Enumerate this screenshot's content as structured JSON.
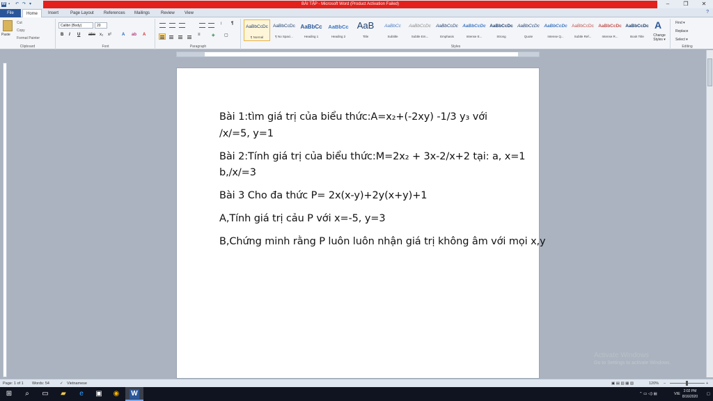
{
  "window": {
    "title": "BÀI TẬP - Microsoft Word (Product Activation Failed)",
    "controls": [
      "–",
      "❐",
      "✕"
    ]
  },
  "qat": {
    "logo": "W"
  },
  "tabs": [
    "File",
    "Home",
    "Insert",
    "Page Layout",
    "References",
    "Mailings",
    "Review",
    "View"
  ],
  "active_tab": "Home",
  "ribbon": {
    "clipboard": {
      "label": "Clipboard",
      "paste": "Paste",
      "cut": "Cut",
      "copy": "Copy",
      "format_painter": "Format Painter"
    },
    "font": {
      "label": "Font",
      "family": "Calibri (Body)",
      "size": "20",
      "bold": "B",
      "italic": "I",
      "underline": "U",
      "strike": "abe",
      "sub": "x₂",
      "sup": "x²"
    },
    "paragraph": {
      "label": "Paragraph"
    },
    "styles": {
      "label": "Styles",
      "items": [
        {
          "sample": "AaBbCcDc",
          "name": "¶ Normal"
        },
        {
          "sample": "AaBbCcDc",
          "name": "¶ No Spaci..."
        },
        {
          "sample": "AaBbCc",
          "name": "Heading 1"
        },
        {
          "sample": "AaBbCc",
          "name": "Heading 2"
        },
        {
          "sample": "AaB",
          "name": "Title"
        },
        {
          "sample": "AaBbCc",
          "name": "Subtitle"
        },
        {
          "sample": "AaBbCcDc",
          "name": "Subtle Em..."
        },
        {
          "sample": "AaBbCcDc",
          "name": "Emphasis"
        },
        {
          "sample": "AaBbCcDc",
          "name": "Intense E..."
        },
        {
          "sample": "AaBbCcDc",
          "name": "Strong"
        },
        {
          "sample": "AaBbCcDc",
          "name": "Quote"
        },
        {
          "sample": "AaBbCcDc",
          "name": "Intense Q..."
        },
        {
          "sample": "AaBbCcDc",
          "name": "Subtle Ref..."
        },
        {
          "sample": "AaBbCcDc",
          "name": "Intense R..."
        },
        {
          "sample": "AaBbCcDc",
          "name": "Book Title"
        }
      ],
      "change_styles": "Change Styles ▾"
    },
    "editing": {
      "label": "Editing",
      "find": "Find ▾",
      "replace": "Replace",
      "select": "Select ▾"
    }
  },
  "document": {
    "lines": [
      "Bài 1:tìm giá trị của biểu thức:A=x₂+(-2xy) -1/3 y₃ với",
      "/x/=5, y=1",
      "Bài 2:Tính giá trị của biểu thức:M=2x₂ + 3x-2/x+2 tại: a, x=1",
      "b,/x/=3",
      "Bài 3 Cho đa thức P= 2x(x-y)+2y(x+y)+1",
      "A,Tính giá trị cảu P với x=-5, y=3",
      "B,Chứng minh rằng P luôn luôn nhận giá trị không âm với mọi x,y"
    ]
  },
  "watermark": {
    "title": "Activate Windows",
    "subtitle": "Go to Settings to activate Windows."
  },
  "status": {
    "page": "Page: 1 of 1",
    "words": "Words: 54",
    "language": "Vietnamese",
    "zoom": "120%"
  },
  "taskbar": {
    "lang": "VIE",
    "time": "2:02 PM",
    "date": "8/16/2020"
  }
}
